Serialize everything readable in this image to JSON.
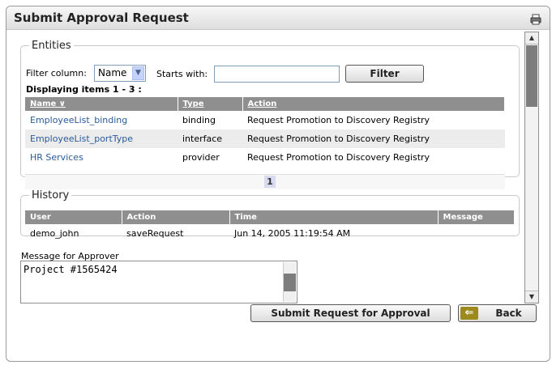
{
  "window": {
    "title": "Submit Approval Request"
  },
  "entities": {
    "legend": "Entities",
    "filter_label": "Filter column:",
    "filter_value": "Name",
    "starts_with_label": "Starts with:",
    "starts_with_value": "",
    "filter_button": "Filter",
    "displaying": "Displaying items 1 - 3 :",
    "columns": [
      "Name ∨",
      "Type",
      "Action"
    ],
    "rows": [
      {
        "name": "EmployeeList_binding",
        "type": "binding",
        "action": "Request Promotion to Discovery Registry"
      },
      {
        "name": "EmployeeList_portType",
        "type": "interface",
        "action": "Request Promotion to Discovery Registry"
      },
      {
        "name": "HR Services",
        "type": "provider",
        "action": "Request Promotion to Discovery Registry"
      }
    ],
    "page": "1"
  },
  "history": {
    "legend": "History",
    "columns": [
      "User",
      "Action",
      "Time",
      "Message"
    ],
    "rows": [
      {
        "user": "demo_john",
        "action": "saveRequest",
        "time": "Jun 14, 2005 11:19:54 AM",
        "message": ""
      }
    ]
  },
  "message": {
    "label": "Message for Approver",
    "value": "Project #1565424"
  },
  "buttons": {
    "submit": "Submit Request for Approval",
    "back": "Back"
  },
  "colors": {
    "header_gray": "#8f8f8f",
    "link_blue": "#2a5a9a",
    "back_icon": "#9c8a1e"
  }
}
